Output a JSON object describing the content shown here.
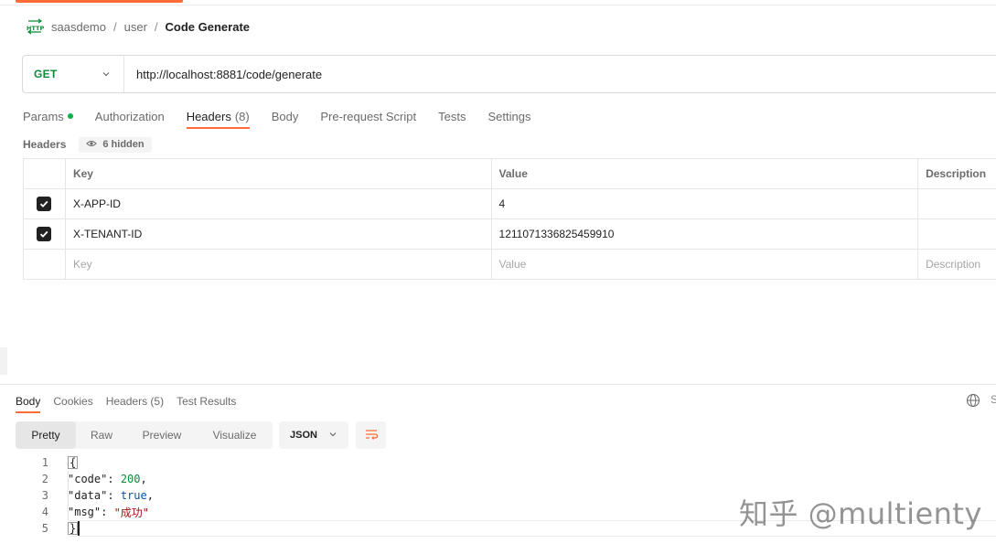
{
  "breadcrumb": {
    "workspace": "saasdemo",
    "collection": "user",
    "request": "Code Generate",
    "separator": "/"
  },
  "request": {
    "method": "GET",
    "url": "http://localhost:8881/code/generate"
  },
  "request_tabs": [
    {
      "label": "Params",
      "count": ""
    },
    {
      "label": "Authorization",
      "count": ""
    },
    {
      "label": "Headers",
      "count": "(8)"
    },
    {
      "label": "Body",
      "count": ""
    },
    {
      "label": "Pre-request Script",
      "count": ""
    },
    {
      "label": "Tests",
      "count": ""
    },
    {
      "label": "Settings",
      "count": ""
    }
  ],
  "headers_section": {
    "title": "Headers",
    "hidden_label": "6 hidden"
  },
  "headers_table": {
    "columns": [
      "Key",
      "Value",
      "Description"
    ],
    "rows": [
      {
        "key": "X-APP-ID",
        "value": "4",
        "description": "",
        "checked": true
      },
      {
        "key": "X-TENANT-ID",
        "value": "1211071336825459910",
        "description": "",
        "checked": true
      }
    ],
    "placeholders": {
      "key": "Key",
      "value": "Value",
      "description": "Description"
    }
  },
  "response_tabs": [
    {
      "label": "Body"
    },
    {
      "label": "Cookies"
    },
    {
      "label": "Headers (5)"
    },
    {
      "label": "Test Results"
    }
  ],
  "response_side_label": "S",
  "view_modes": [
    "Pretty",
    "Raw",
    "Preview",
    "Visualize"
  ],
  "format": "JSON",
  "code": {
    "line_numbers": [
      "1",
      "2",
      "3",
      "4",
      "5"
    ],
    "open_brace": "{",
    "close_brace": "}",
    "line2": {
      "key": "\"code\"",
      "colon": ": ",
      "value": "200",
      "comma": ","
    },
    "line3": {
      "key": "\"data\"",
      "colon": ": ",
      "value": "true",
      "comma": ","
    },
    "line4": {
      "key": "\"msg\"",
      "colon": ": ",
      "value": "\"成功\""
    }
  },
  "watermark": "知乎 @multienty",
  "colors": {
    "accent": "#ff6c37",
    "method_get": "#0b8a39",
    "active_dot": "#0bb14a"
  }
}
